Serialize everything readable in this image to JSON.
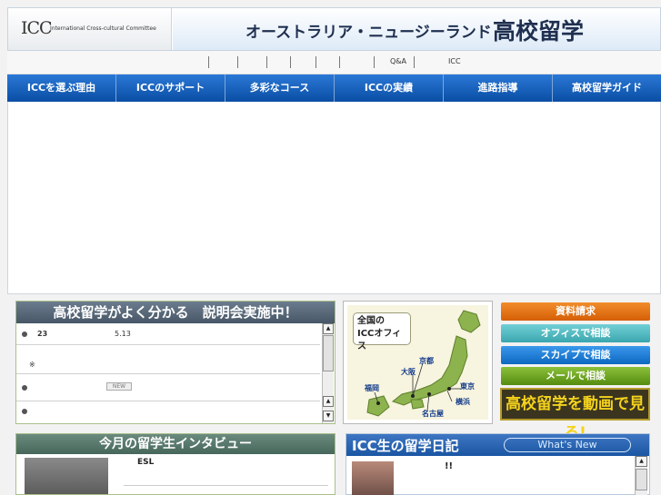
{
  "header": {
    "logo_mark": "ICC",
    "logo_text": "International Cross-cultural Committee",
    "title_sub": "オーストラリア・ニュージーランド",
    "title_main": "高校留学"
  },
  "sublinks": [
    "Q&A",
    "ICC"
  ],
  "nav": [
    "ICCを選ぶ理由",
    "ICCのサポート",
    "多彩なコース",
    "ICCの実績",
    "進路指導",
    "高校留学ガイド"
  ],
  "seminar": {
    "title": "高校留学がよく分かる　説明会実施中！",
    "rows": [
      {
        "day": "23",
        "date": "5.13"
      },
      {
        "note": "※"
      },
      {
        "badge": "NEW"
      },
      {}
    ]
  },
  "map": {
    "title_line1": "全国の",
    "title_line2": "ICCオフィス",
    "cities": [
      "京都",
      "大阪",
      "東京",
      "福岡",
      "横浜",
      "名古屋"
    ]
  },
  "side_buttons": {
    "request": "資料請求",
    "office": "オフィスで相談",
    "skype": "スカイプで相談",
    "mail": "メールで相談",
    "video": "高校留学を動画で見る!"
  },
  "interview": {
    "title": "今月の留学生インタビュー",
    "text": "ESL"
  },
  "diary": {
    "title": "ICC生の留学日記",
    "whats_new": "What's New",
    "text": "!!"
  },
  "colors": {
    "nav": "#1459b3",
    "request_btn": "#e67514",
    "office_btn": "#54b9c1",
    "skype_btn": "#1d7fd8",
    "mail_btn": "#6fa51e",
    "video_text": "#f5d31c"
  }
}
